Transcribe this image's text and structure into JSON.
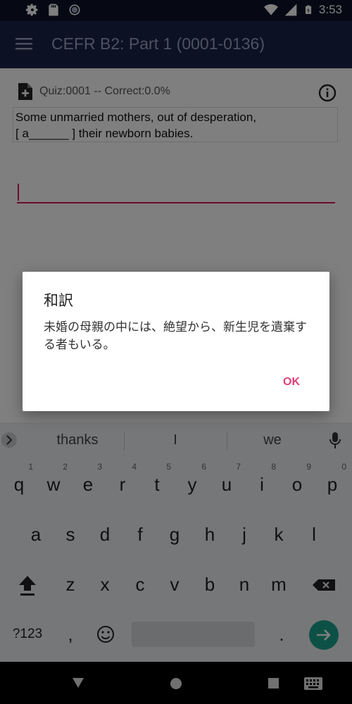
{
  "status_bar": {
    "time": "3:53"
  },
  "toolbar": {
    "title": "CEFR B2: Part 1 (0001-0136)"
  },
  "quiz": {
    "label": "Quiz:0001  -- Correct:0.0%",
    "question_line1": "Some unmarried mothers, out of desperation,",
    "question_line2": "[ a______ ] their newborn babies.",
    "answer_value": ""
  },
  "dialog": {
    "title": "和訳",
    "message": "未婚の母親の中には、絶望から、新生児を遺棄する者もいる。",
    "ok_label": "OK"
  },
  "keyboard": {
    "suggestions": [
      "thanks",
      "I",
      "we"
    ],
    "row1": [
      {
        "k": "q",
        "h": "1"
      },
      {
        "k": "w",
        "h": "2"
      },
      {
        "k": "e",
        "h": "3"
      },
      {
        "k": "r",
        "h": "4"
      },
      {
        "k": "t",
        "h": "5"
      },
      {
        "k": "y",
        "h": "6"
      },
      {
        "k": "u",
        "h": "7"
      },
      {
        "k": "i",
        "h": "8"
      },
      {
        "k": "o",
        "h": "9"
      },
      {
        "k": "p",
        "h": "0"
      }
    ],
    "row2": [
      "a",
      "s",
      "d",
      "f",
      "g",
      "h",
      "j",
      "k",
      "l"
    ],
    "row3": [
      "z",
      "x",
      "c",
      "v",
      "b",
      "n",
      "m"
    ],
    "symbols_label": "?123",
    "comma_label": ",",
    "period_label": "."
  },
  "colors": {
    "status_bar": "#0c1328",
    "toolbar": "#182248",
    "accent": "#d81b60",
    "enter_key": "#1aa38c"
  }
}
